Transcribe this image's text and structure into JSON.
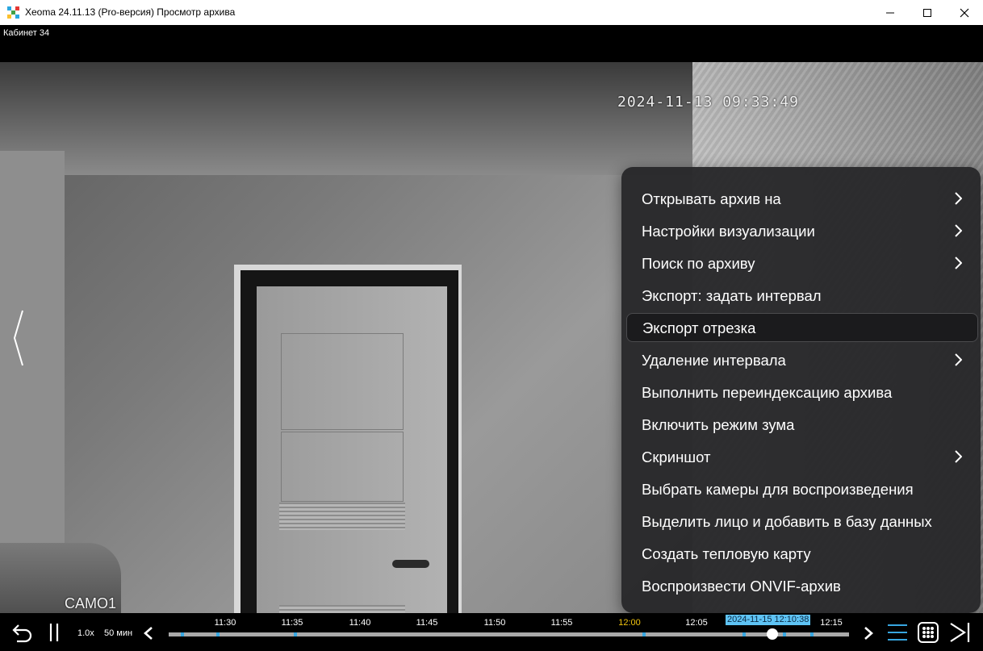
{
  "window": {
    "title": "Xeoma 24.11.13 (Pro-версия) Просмотр архива",
    "controls": [
      "minimize-icon",
      "maximize-icon",
      "close-icon"
    ]
  },
  "camera": {
    "name": "Кабинет 34",
    "osd_timestamp": "2024-11-13 09:33:49",
    "osd_label": "CAMO1"
  },
  "menu": {
    "items": [
      {
        "label": "Открывать архив на",
        "submenu": true
      },
      {
        "label": "Настройки визуализации",
        "submenu": true
      },
      {
        "label": "Поиск по архиву",
        "submenu": true
      },
      {
        "label": "Экспорт: задать интервал",
        "submenu": false
      },
      {
        "label": "Экспорт отрезка",
        "submenu": false,
        "selected": true
      },
      {
        "label": "Удаление интервала",
        "submenu": true
      },
      {
        "label": "Выполнить переиндексацию архива",
        "submenu": false
      },
      {
        "label": "Включить режим зума",
        "submenu": false
      },
      {
        "label": "Скриншот",
        "submenu": true
      },
      {
        "label": "Выбрать камеры для воспроизведения",
        "submenu": false
      },
      {
        "label": "Выделить лицо и добавить в базу данных",
        "submenu": false
      },
      {
        "label": "Создать тепловую карту",
        "submenu": false
      },
      {
        "label": "Воспроизвести ONVIF-архив",
        "submenu": false
      }
    ]
  },
  "playback": {
    "speed": "1.0x",
    "scale": "50 мин",
    "timeline_ticks": [
      "11:30",
      "11:35",
      "11:40",
      "11:45",
      "11:50",
      "11:55",
      "12:00",
      "12:05",
      "12:10",
      "12:15"
    ],
    "current_tick": "12:00",
    "position_label": "2024-11-15 12:10:38",
    "colors": {
      "accent": "#37a6e0",
      "now_tick": "#f1c40f",
      "badge": "#5ec3f4"
    }
  }
}
